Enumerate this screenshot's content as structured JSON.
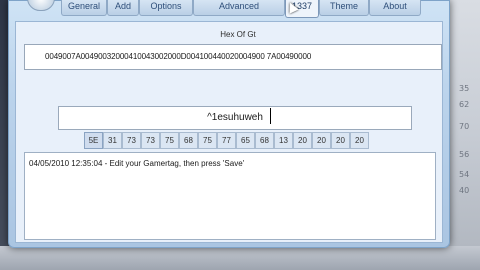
{
  "tabs": [
    {
      "label": "General",
      "active": false
    },
    {
      "label": "Add",
      "active": false
    },
    {
      "label": "Options",
      "active": false
    },
    {
      "label": "Advanced",
      "active": false
    },
    {
      "label": "1337",
      "active": true
    },
    {
      "label": "Theme",
      "active": false
    },
    {
      "label": "About",
      "active": false
    }
  ],
  "hex_group": {
    "title": "Hex Of Gt",
    "value": "0049007A00490032000410043002000D004100440020004900 7A00490000"
  },
  "gamertag": {
    "value": "^1esuhuweh"
  },
  "hex_bytes": [
    "5E",
    "31",
    "73",
    "73",
    "75",
    "68",
    "75",
    "77",
    "65",
    "68",
    "13",
    "20",
    "20",
    "20",
    "20"
  ],
  "log": {
    "lines": [
      "04/05/2010 12:35:04 - Edit your Gamertag, then press 'Save'"
    ]
  },
  "background_numbers": [
    "35",
    "62",
    "70",
    "56",
    "54",
    "40"
  ]
}
